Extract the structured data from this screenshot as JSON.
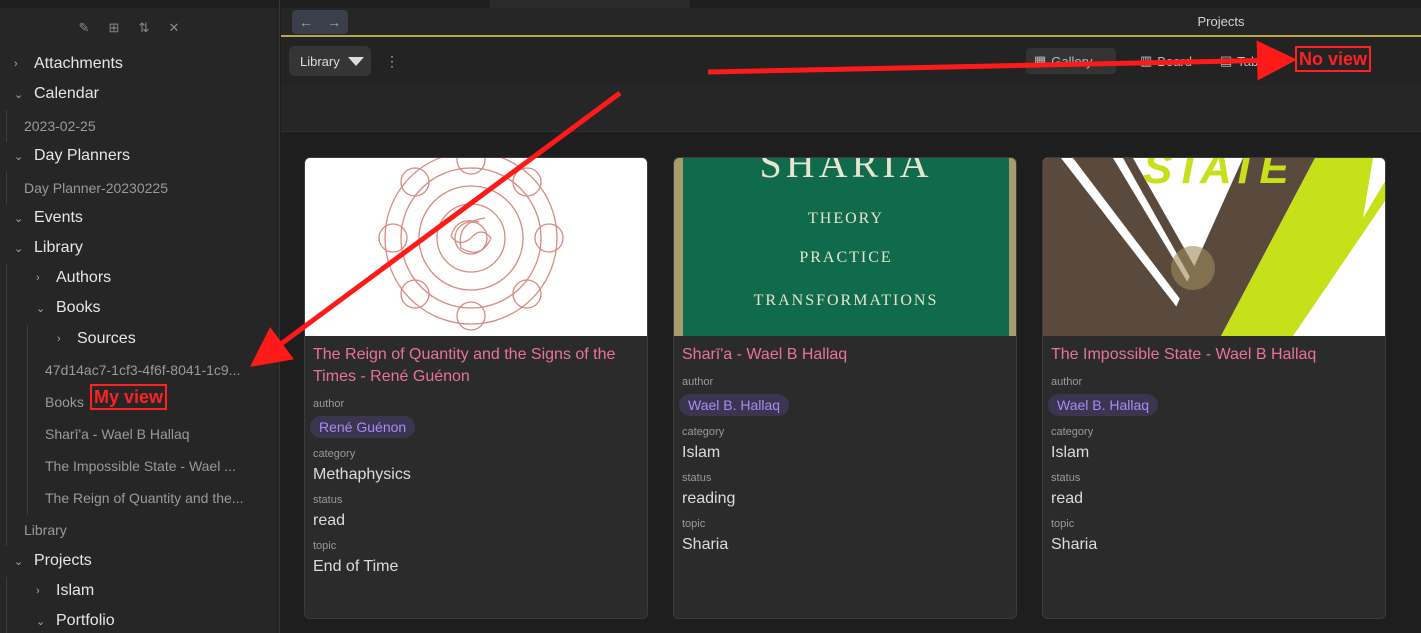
{
  "sidebar": {
    "toolbar_icons": [
      "new-note-icon",
      "new-folder-icon",
      "sort-icon",
      "collapse-all-icon"
    ],
    "items": [
      {
        "label": "Attachments"
      },
      {
        "label": "Calendar"
      },
      {
        "label": "2023-02-25"
      },
      {
        "label": "Day Planners"
      },
      {
        "label": "Day Planner-20230225"
      },
      {
        "label": "Events"
      },
      {
        "label": "Library"
      },
      {
        "label": "Authors"
      },
      {
        "label": "Books"
      },
      {
        "label": "Sources"
      },
      {
        "label": "47d14ac7-1cf3-4f6f-8041-1c9..."
      },
      {
        "label": "Books"
      },
      {
        "label": "Sharī'a - Wael B Hallaq"
      },
      {
        "label": "The Impossible State - Wael ..."
      },
      {
        "label": "The Reign of Quantity and the..."
      },
      {
        "label": "Library"
      },
      {
        "label": "Projects"
      },
      {
        "label": "Islam"
      },
      {
        "label": "Portfolio"
      }
    ]
  },
  "header": {
    "title": "Projects",
    "library_select": "Library",
    "views": [
      {
        "label": "Gallery"
      },
      {
        "label": "Board"
      },
      {
        "label": "Table"
      }
    ]
  },
  "cards": [
    {
      "title": "The Reign of Quantity and the Signs of the Times - René Guénon",
      "author_label": "author",
      "author": "René Guénon",
      "category_label": "category",
      "category": "Methaphysics",
      "status_label": "status",
      "status": "read",
      "topic_label": "topic",
      "topic": "End of Time"
    },
    {
      "title": "Sharī'a - Wael B Hallaq",
      "author_label": "author",
      "author": "Wael B. Hallaq",
      "category_label": "category",
      "category": "Islam",
      "status_label": "status",
      "status": "reading",
      "topic_label": "topic",
      "topic": "Sharia",
      "cover_text": [
        "SHARIA",
        "THEORY",
        "PRACTICE",
        "TRANSFORMATIONS"
      ]
    },
    {
      "title": "The Impossible State - Wael B Hallaq",
      "author_label": "author",
      "author": "Wael B. Hallaq",
      "category_label": "category",
      "category": "Islam",
      "status_label": "status",
      "status": "read",
      "topic_label": "topic",
      "topic": "Sharia",
      "cover_text": [
        "STATE"
      ]
    }
  ],
  "annotations": {
    "no_view": "No view",
    "my_view": "My view"
  },
  "colors": {
    "accent_pink": "#e9739a",
    "tag_purple": "#a98bf5",
    "annotation_red": "#ff2222",
    "title_underline": "#b9a64a"
  }
}
